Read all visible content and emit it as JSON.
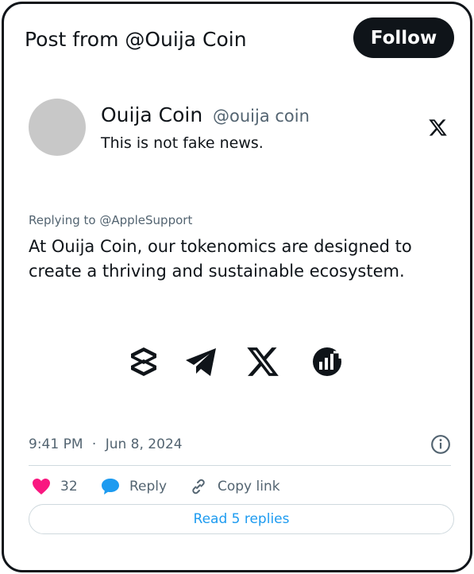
{
  "header": {
    "title": "Post from @Ouija Coin",
    "follow_label": "Follow"
  },
  "author": {
    "name": "Ouija Coin",
    "handle": "@ouija coin",
    "bio": "This is not fake news."
  },
  "post": {
    "replying_to": "Replying to @AppleSupport",
    "text": "At Ouija Coin, our tokenomics are designed to create a thriving and sustainable ecosystem.",
    "social_icons": [
      "dextools-icon",
      "telegram-icon",
      "x-logo-icon",
      "dexscreener-icon"
    ]
  },
  "meta": {
    "time": "9:41 PM",
    "separator": "·",
    "date": "Jun 8, 2024"
  },
  "actions": {
    "like_count": "32",
    "reply_label": "Reply",
    "copy_link_label": "Copy link",
    "read_replies_label": "Read 5 replies"
  },
  "colors": {
    "text": "#0f1419",
    "secondary": "#536471",
    "accent": "#1d9bf0",
    "like": "#f91880",
    "avatar": "#c8c8c8",
    "divider": "#cfd9de"
  }
}
